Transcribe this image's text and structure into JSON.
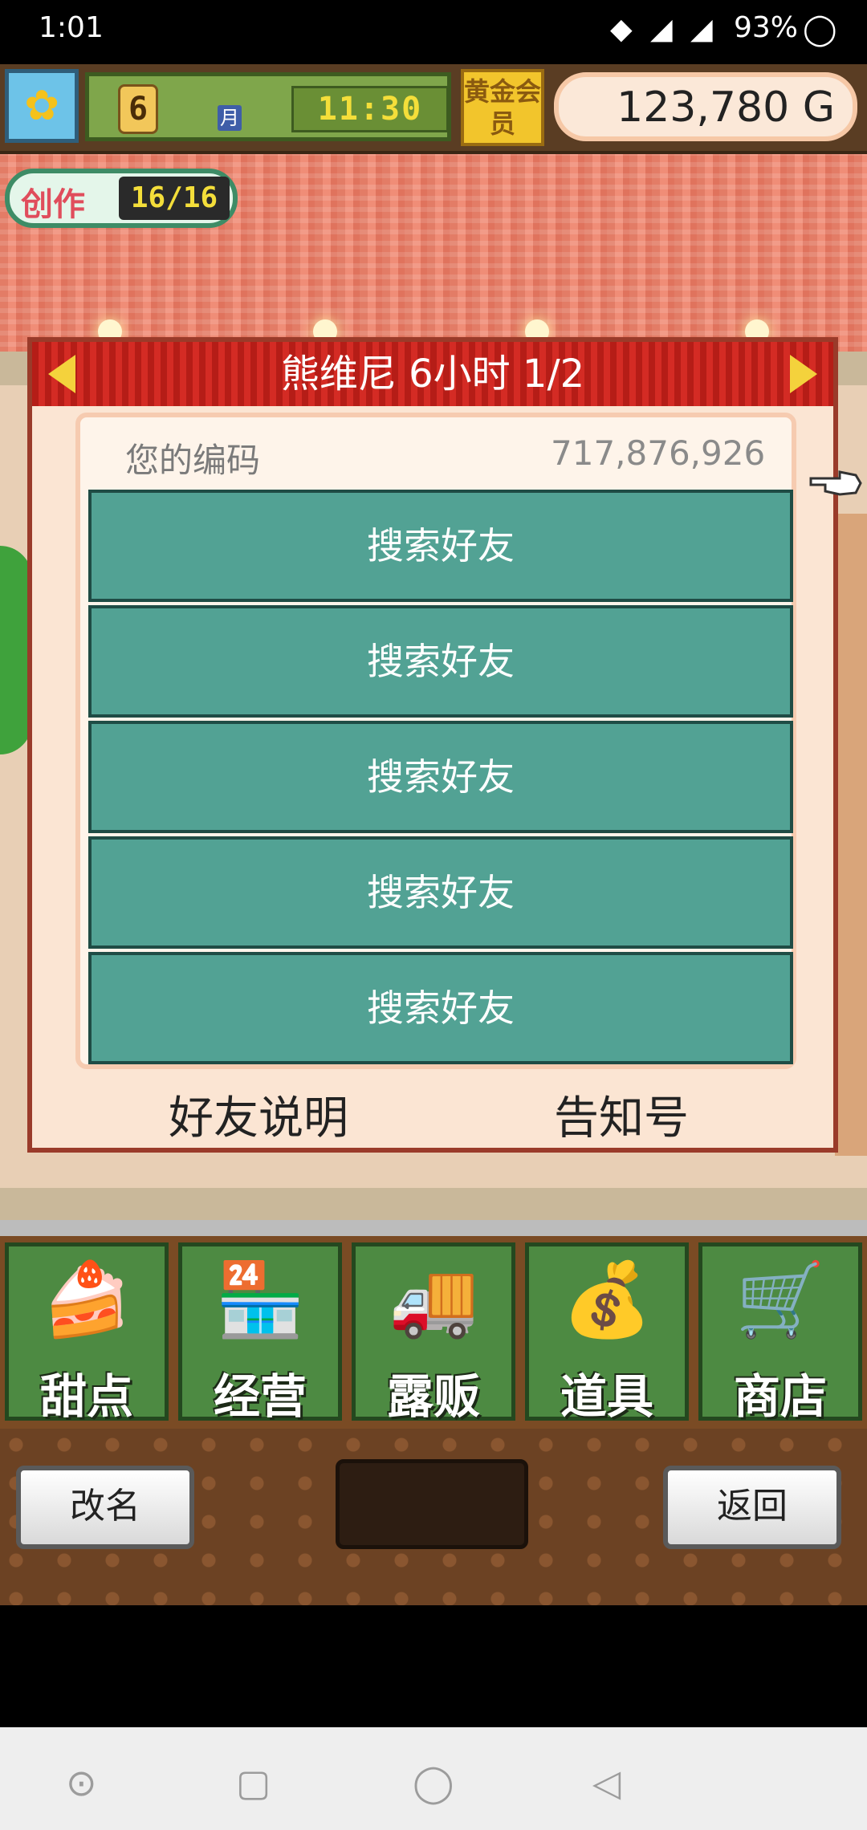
{
  "status_bar": {
    "time": "1:01",
    "battery": "93%"
  },
  "hud": {
    "month_number": "6",
    "month_label": "月",
    "clock": "11:30",
    "gold_member": "黄金会员",
    "money": "123,780 G",
    "create_label": "创作",
    "create_value": "16/16"
  },
  "dialog": {
    "title": "熊维尼  6小时 1/2",
    "your_code_label": "您的编码",
    "your_code_value": "717,876,926",
    "friend_buttons": [
      "搜索好友",
      "搜索好友",
      "搜索好友",
      "搜索好友",
      "搜索好友"
    ],
    "footer_left": "好友说明",
    "footer_right": "告知号"
  },
  "menu": {
    "items": [
      {
        "label": "甜点",
        "icon": "cake-icon"
      },
      {
        "label": "经营",
        "icon": "shop-icon"
      },
      {
        "label": "露贩",
        "icon": "food-truck-icon"
      },
      {
        "label": "道具",
        "icon": "sack-icon"
      },
      {
        "label": "商店",
        "icon": "cart-icon"
      }
    ]
  },
  "footer": {
    "rename": "改名",
    "back": "返回"
  },
  "colors": {
    "dialog_header": "#c6241d",
    "friend_button": "#52a294",
    "menu_tile": "#4d8a42",
    "gold": "#f2c52c"
  }
}
